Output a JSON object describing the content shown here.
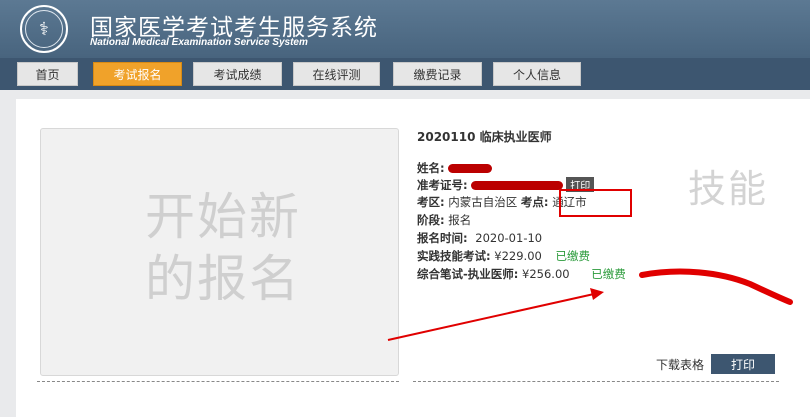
{
  "header": {
    "title_cn": "国家医学考试考生服务系统",
    "title_en": "National Medical Examination Service System",
    "logo_icon": "medical-emblem-icon"
  },
  "nav": [
    {
      "label": "首页",
      "active": false
    },
    {
      "label": "考试报名",
      "active": true
    },
    {
      "label": "考试成绩",
      "active": false
    },
    {
      "label": "在线评测",
      "active": false
    },
    {
      "label": "缴费记录",
      "active": false
    },
    {
      "label": "个人信息",
      "active": false
    }
  ],
  "new_registration": {
    "line1": "开始新",
    "line2": "的报名"
  },
  "exam": {
    "title": "2020110 临床执业医师",
    "name_label": "姓名:",
    "ticket_label": "准考证号:",
    "ticket_print": "打印",
    "region_label": "考区:",
    "region_value": "内蒙古自治区",
    "site_label": "考点:",
    "site_value": "通辽市",
    "stage_label": "阶段:",
    "stage_value": "报名",
    "time_label": "报名时间:",
    "time_value": "2020-01-10",
    "skill_label": "实践技能考试:",
    "skill_fee": "¥229.00",
    "skill_status": "已缴费",
    "written_label": "综合笔试-执业医师:",
    "written_fee": "¥256.00",
    "written_status": "已缴费",
    "watermark": "技能"
  },
  "actions": {
    "download": "下载表格",
    "print": "打印"
  },
  "colors": {
    "nav_active": "#f0a22a",
    "header": "#48647e",
    "paid": "#2b9b3b",
    "annotation": "#e00000"
  }
}
